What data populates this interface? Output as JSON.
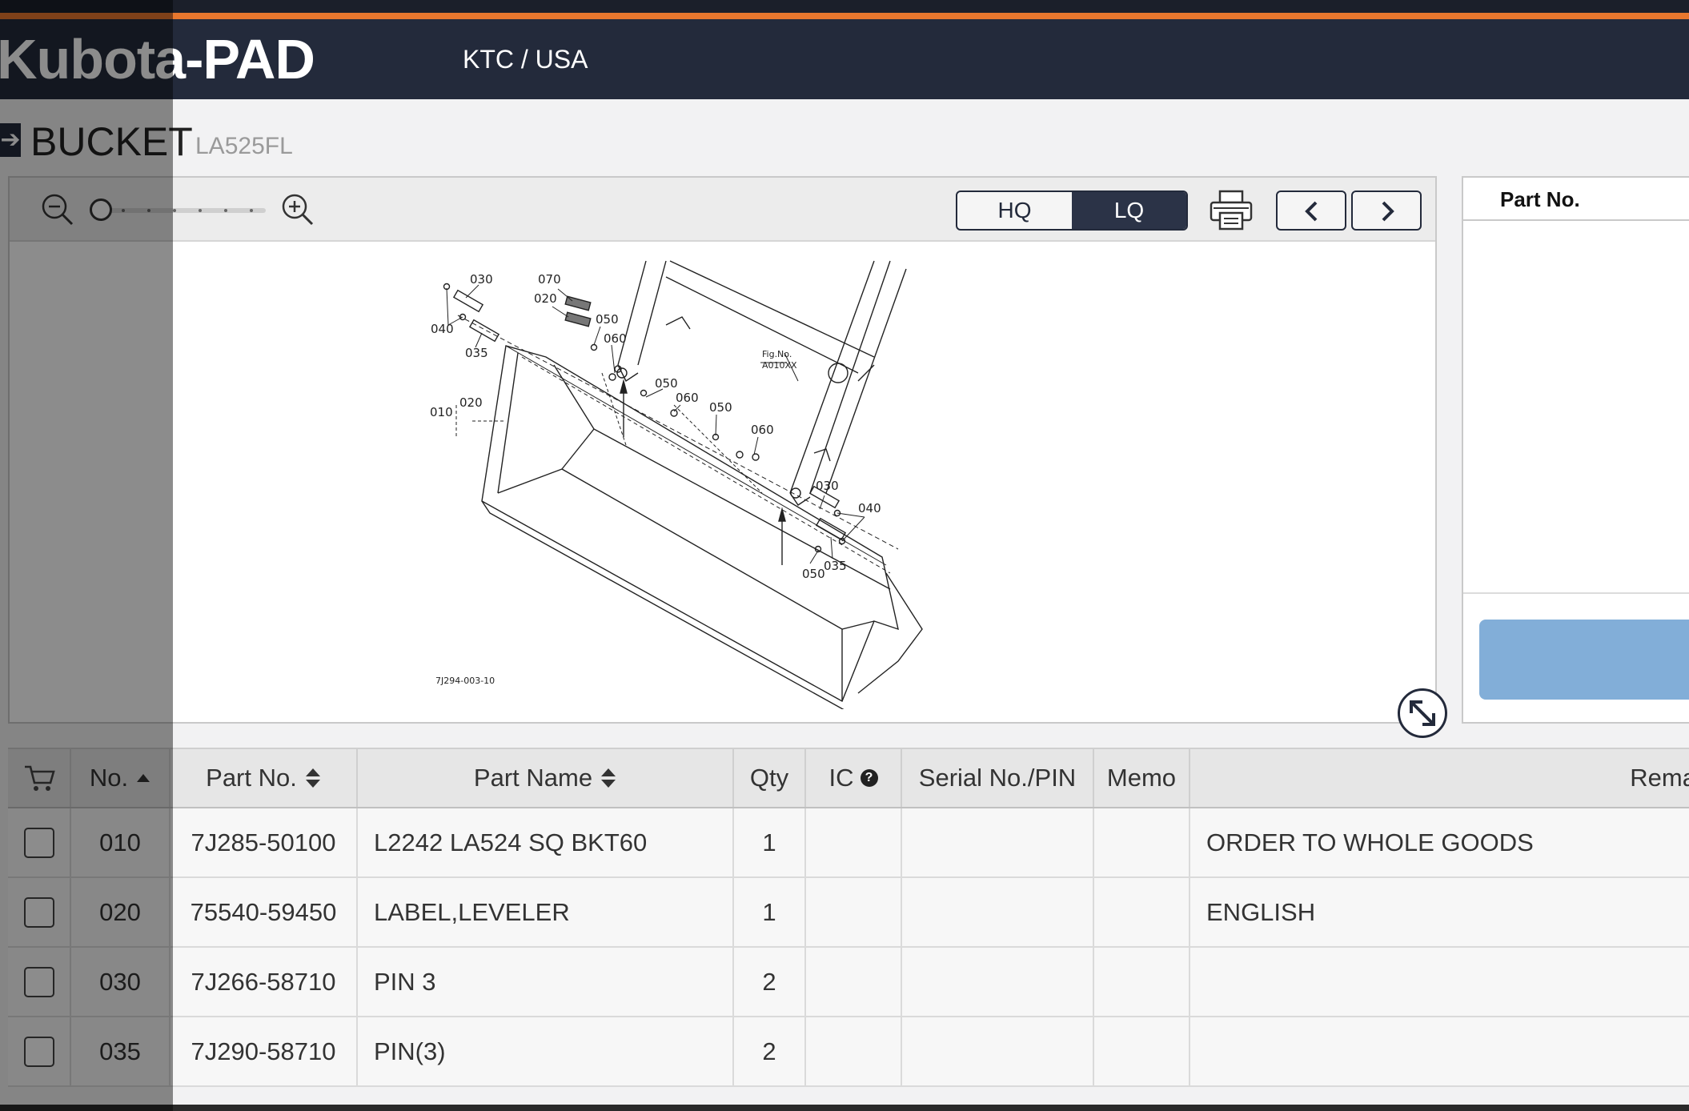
{
  "header": {
    "logo": "Kubota-PAD",
    "region": "KTC / USA"
  },
  "page": {
    "title": "BUCKET",
    "model": "LA525FL"
  },
  "viewer": {
    "quality_hq": "HQ",
    "quality_lq": "LQ",
    "quality_selected": "LQ",
    "zoom_icons": [
      "zoom-out-icon",
      "zoom-in-icon"
    ],
    "diagram": {
      "fig_label": "Fig.No.",
      "fig_no": "A010XX",
      "drawing_no": "7J294-003-10",
      "callouts": [
        "030",
        "070",
        "020",
        "040",
        "050",
        "060",
        "035",
        "050",
        "060",
        "050",
        "010",
        "020",
        "060",
        "030",
        "040",
        "035",
        "050"
      ]
    }
  },
  "right_panel": {
    "header": "Part No."
  },
  "table": {
    "columns": {
      "no": "No.",
      "part_no": "Part No.",
      "part_name": "Part Name",
      "qty": "Qty",
      "ic": "IC",
      "serial": "Serial No./PIN",
      "memo": "Memo",
      "remarks": "Rema"
    },
    "rows": [
      {
        "no": "010",
        "part_no": "7J285-50100",
        "part_name": "L2242 LA524 SQ BKT60",
        "qty": "1",
        "ic": "",
        "serial": "",
        "memo": "",
        "remarks": "ORDER TO WHOLE GOODS"
      },
      {
        "no": "020",
        "part_no": "75540-59450",
        "part_name": "LABEL,LEVELER",
        "qty": "1",
        "ic": "",
        "serial": "",
        "memo": "",
        "remarks": "ENGLISH"
      },
      {
        "no": "030",
        "part_no": "7J266-58710",
        "part_name": "PIN 3",
        "qty": "2",
        "ic": "",
        "serial": "",
        "memo": "",
        "remarks": ""
      },
      {
        "no": "035",
        "part_no": "7J290-58710",
        "part_name": "PIN(3)",
        "qty": "2",
        "ic": "",
        "serial": "",
        "memo": "",
        "remarks": ""
      }
    ]
  },
  "colors": {
    "header_bg": "#232a3b",
    "accent_orange": "#e8772e",
    "button_blue": "#82aed8"
  }
}
